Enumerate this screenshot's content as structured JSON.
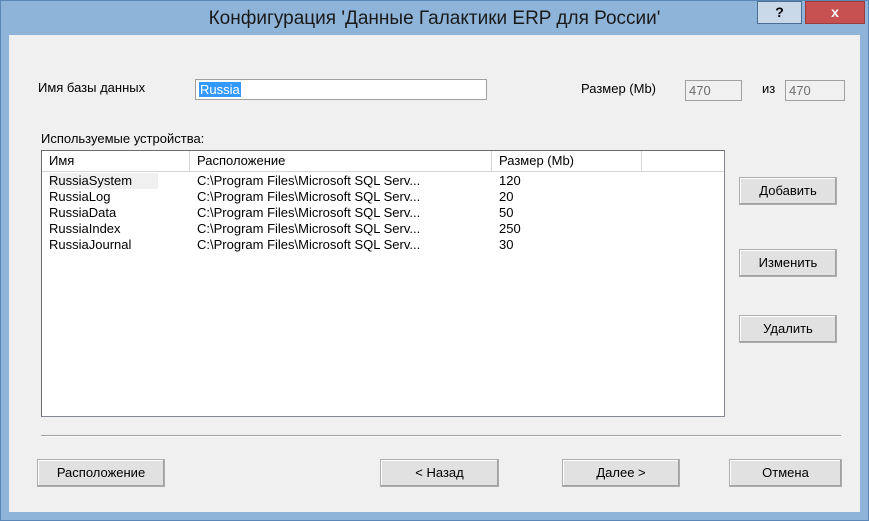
{
  "window": {
    "title": "Конфигурация 'Данные Галактики ERP для России'",
    "help_glyph": "?",
    "close_glyph": "x"
  },
  "db": {
    "name_label": "Имя базы данных",
    "name_value": "Russia",
    "size_label": "Размер (Mb)",
    "size_value": "470",
    "of_label": "из",
    "of_value": "470"
  },
  "devices": {
    "label": "Используемые устройства:",
    "columns": [
      "Имя",
      "Расположение",
      "Размер (Mb)",
      ""
    ],
    "rows": [
      {
        "name": "RussiaSystem",
        "location": "C:\\Program Files\\Microsoft SQL Serv...",
        "size": "120"
      },
      {
        "name": "RussiaLog",
        "location": "C:\\Program Files\\Microsoft SQL Serv...",
        "size": "20"
      },
      {
        "name": "RussiaData",
        "location": "C:\\Program Files\\Microsoft SQL Serv...",
        "size": "50"
      },
      {
        "name": "RussiaIndex",
        "location": "C:\\Program Files\\Microsoft SQL Serv...",
        "size": "250"
      },
      {
        "name": "RussiaJournal",
        "location": "C:\\Program Files\\Microsoft SQL Serv...",
        "size": "30"
      }
    ]
  },
  "side_buttons": {
    "add": "Добавить",
    "edit": "Изменить",
    "delete": "Удалить"
  },
  "bottom_buttons": {
    "location": "Расположение",
    "back": "< Назад",
    "next": "Далее >",
    "cancel": "Отмена"
  },
  "colors": {
    "titlebar": "#8fb4d9",
    "close_button": "#c75050",
    "selection": "#3399ff"
  }
}
